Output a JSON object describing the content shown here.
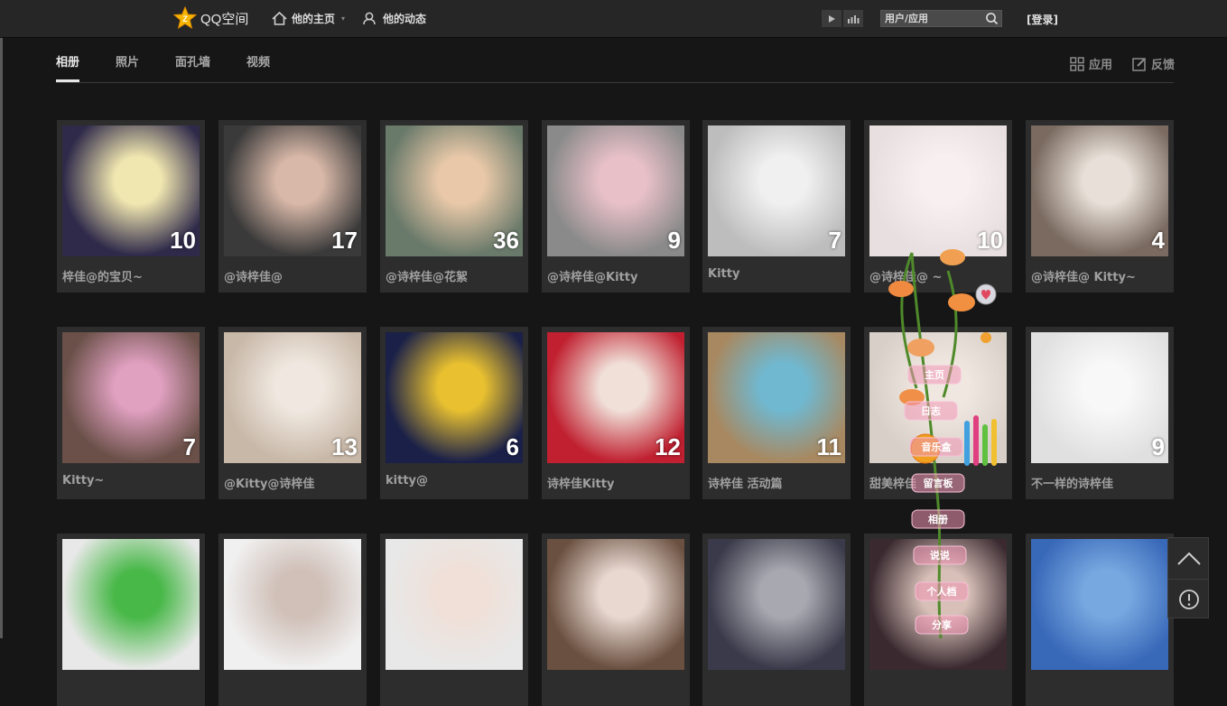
{
  "app": {
    "name": "QQ空间"
  },
  "topnav": {
    "home": "他的主页",
    "activity": "他的动态",
    "search_placeholder": "用户/应用",
    "login": "[登录]"
  },
  "tabs": [
    {
      "label": "相册",
      "active": true
    },
    {
      "label": "照片",
      "active": false
    },
    {
      "label": "面孔墙",
      "active": false
    },
    {
      "label": "视频",
      "active": false
    }
  ],
  "actions": {
    "apps": "应用",
    "feedback": "反馈"
  },
  "albums": [
    {
      "title": "梓佳@的宝贝~",
      "count": "10",
      "tone": [
        "#2f2a4a",
        "#f0e6b0"
      ]
    },
    {
      "title": "@诗梓佳@",
      "count": "17",
      "tone": [
        "#3a3a3a",
        "#d8b8a8"
      ]
    },
    {
      "title": "@诗梓佳@花絮",
      "count": "36",
      "tone": [
        "#6a7a6a",
        "#e8c8a8"
      ]
    },
    {
      "title": "@诗梓佳@Kitty",
      "count": "9",
      "tone": [
        "#8a8a8a",
        "#e8c0c8"
      ]
    },
    {
      "title": "Kitty",
      "count": "7",
      "tone": [
        "#bdbdbd",
        "#f0f0f0"
      ]
    },
    {
      "title": "@诗梓佳@ ~",
      "count": "10",
      "tone": [
        "#e8e0e0",
        "#f8f0f0"
      ]
    },
    {
      "title": "@诗梓佳@ Kitty~",
      "count": "4",
      "tone": [
        "#7a6a60",
        "#e8e0d8"
      ]
    },
    {
      "title": "Kitty~",
      "count": "7",
      "tone": [
        "#6a5048",
        "#e0a0c0"
      ]
    },
    {
      "title": "@Kitty@诗梓佳",
      "count": "13",
      "tone": [
        "#c8b8a8",
        "#f0e8e0"
      ]
    },
    {
      "title": "kitty@",
      "count": "6",
      "tone": [
        "#1a2048",
        "#e8c030"
      ]
    },
    {
      "title": "诗梓佳Kitty",
      "count": "12",
      "tone": [
        "#c02030",
        "#f0e0d8"
      ]
    },
    {
      "title": "诗梓佳 活动篇",
      "count": "11",
      "tone": [
        "#a88860",
        "#70b8d0"
      ]
    },
    {
      "title": "甜美梓佳",
      "count": "",
      "tone": [
        "#d8d0c8",
        "#f0e8e0"
      ]
    },
    {
      "title": "不一样的诗梓佳",
      "count": "9",
      "tone": [
        "#e0e0e0",
        "#f8f8f8"
      ]
    },
    {
      "title": "",
      "count": "",
      "tone": [
        "#e8e8e8",
        "#48b848"
      ]
    },
    {
      "title": "",
      "count": "",
      "tone": [
        "#f0f0f0",
        "#d0c0b8"
      ]
    },
    {
      "title": "",
      "count": "",
      "tone": [
        "#e8e8e8",
        "#f0e0d8"
      ]
    },
    {
      "title": "",
      "count": "",
      "tone": [
        "#6a5040",
        "#e8d8d0"
      ]
    },
    {
      "title": "",
      "count": "",
      "tone": [
        "#3a3a4a",
        "#a8a8b0"
      ]
    },
    {
      "title": "",
      "count": "",
      "tone": [
        "#3a2a30",
        "#d8c0b8"
      ]
    },
    {
      "title": "",
      "count": "",
      "tone": [
        "#3868b8",
        "#78a8e0"
      ]
    }
  ],
  "flower_menu": [
    "主页",
    "日志",
    "音乐盒",
    "留言板",
    "相册",
    "说说",
    "个人档",
    "分享"
  ],
  "colors": {
    "background": "#161616",
    "topbar": "#262626",
    "card": "#2d2d2d"
  }
}
